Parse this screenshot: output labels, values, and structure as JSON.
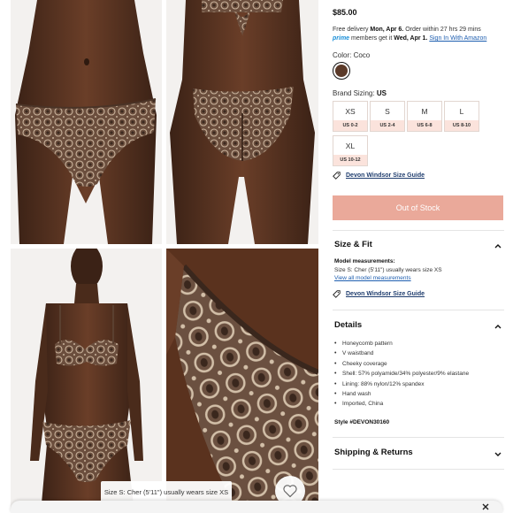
{
  "product": {
    "price": "$85.00",
    "delivery": {
      "prefix": "Free delivery ",
      "date": "Mon, Apr 6.",
      "mid": " Order within 27 hrs 29 mins",
      "prime": "prime",
      "members": " members get it ",
      "prime_date": "Wed, Apr 1.",
      "signin": "Sign In With Amazon"
    },
    "color_label": "Color: Coco",
    "swatch_color": "#5b3a29",
    "sizing": {
      "label": "Brand Sizing: ",
      "value": "US"
    },
    "sizes": [
      {
        "size": "XS",
        "us": "US 0-2"
      },
      {
        "size": "S",
        "us": "US 2-4"
      },
      {
        "size": "M",
        "us": "US 6-8"
      },
      {
        "size": "L",
        "us": "US 8-10"
      },
      {
        "size": "XL",
        "us": "US 10-12"
      }
    ],
    "size_guide": "Devon Windsor Size Guide",
    "cta": "Out of Stock",
    "cta_color": "#eaa99a"
  },
  "size_fit": {
    "title": "Size & Fit",
    "model_label": "Model measurements:",
    "model_text": "Size S: Cher (5'11\") usually wears size XS",
    "view_all": "View all model measurements",
    "guide": "Devon Windsor Size Guide"
  },
  "details": {
    "title": "Details",
    "items": [
      "Honeycomb pattern",
      "V waistband",
      "Cheeky coverage",
      "Shell: 57% polyamide/34% polyester/9% elastane",
      "Lining: 88% nylon/12% spandex",
      "Hand wash",
      "Imported, China"
    ],
    "style": "Style #DEVON30160"
  },
  "shipping": {
    "title": "Shipping & Returns"
  },
  "gallery": {
    "caption": "Size S: Cher (5'11\") usually wears size XS"
  },
  "icons": {
    "tag": "tag-icon",
    "chevron_up": "chevron-up-icon",
    "chevron_down": "chevron-down-icon",
    "heart": "heart-icon",
    "close": "close-icon"
  }
}
